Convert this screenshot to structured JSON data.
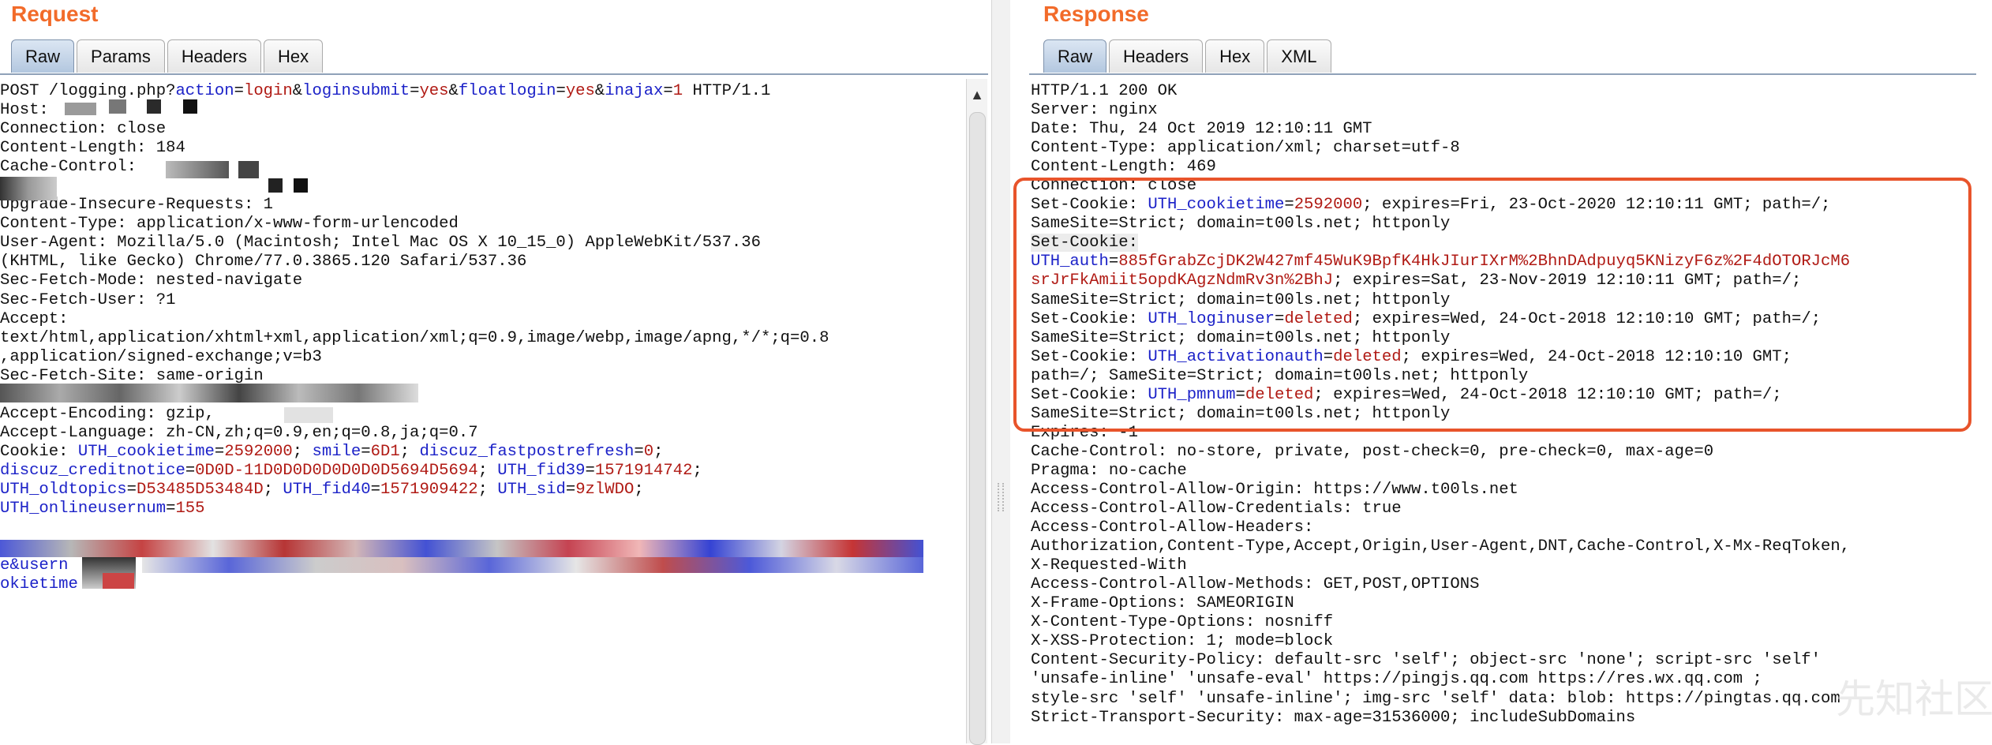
{
  "request": {
    "title": "Request",
    "tabs": [
      "Raw",
      "Params",
      "Headers",
      "Hex"
    ],
    "lines": [
      [
        {
          "t": "POST /logging.php?"
        },
        {
          "t": "action",
          "c": "k"
        },
        {
          "t": "="
        },
        {
          "t": "login",
          "c": "v"
        },
        {
          "t": "&"
        },
        {
          "t": "loginsubmit",
          "c": "k"
        },
        {
          "t": "="
        },
        {
          "t": "yes",
          "c": "v"
        },
        {
          "t": "&"
        },
        {
          "t": "floatlogin",
          "c": "k"
        },
        {
          "t": "="
        },
        {
          "t": "yes",
          "c": "v"
        },
        {
          "t": "&"
        },
        {
          "t": "inajax",
          "c": "k"
        },
        {
          "t": "="
        },
        {
          "t": "1",
          "c": "v"
        },
        {
          "t": " HTTP/1.1"
        }
      ],
      [
        {
          "t": "Host:"
        }
      ],
      [
        {
          "t": "Connection: close"
        }
      ],
      [
        {
          "t": "Content-Length: 184"
        }
      ],
      [
        {
          "t": "Cache-Control:"
        }
      ],
      [
        {
          "t": ""
        }
      ],
      [
        {
          "t": "Upgrade-Insecure-Requests: 1"
        }
      ],
      [
        {
          "t": "Content-Type: application/x-www-form-urlencoded"
        }
      ],
      [
        {
          "t": "User-Agent: Mozilla/5.0 (Macintosh; Intel Mac OS X 10_15_0) AppleWebKit/537.36"
        }
      ],
      [
        {
          "t": "(KHTML, like Gecko) Chrome/77.0.3865.120 Safari/537.36"
        }
      ],
      [
        {
          "t": "Sec-Fetch-Mode: nested-navigate"
        }
      ],
      [
        {
          "t": "Sec-Fetch-User: ?1"
        }
      ],
      [
        {
          "t": "Accept:"
        }
      ],
      [
        {
          "t": "text/html,application/xhtml+xml,application/xml;q=0.9,image/webp,image/apng,*/*;q=0.8"
        }
      ],
      [
        {
          "t": ",application/signed-exchange;v=b3"
        }
      ],
      [
        {
          "t": "Sec-Fetch-Site: same-origin"
        }
      ],
      [
        {
          "t": ""
        }
      ],
      [
        {
          "t": "Accept-Encoding: gzip,"
        }
      ],
      [
        {
          "t": "Accept-Language: zh-CN,zh;q=0.9,en;q=0.8,ja;q=0.7"
        }
      ],
      [
        {
          "t": "Cookie: "
        },
        {
          "t": "UTH_cookietime",
          "c": "k"
        },
        {
          "t": "="
        },
        {
          "t": "2592000",
          "c": "v"
        },
        {
          "t": "; "
        },
        {
          "t": "smile",
          "c": "k"
        },
        {
          "t": "="
        },
        {
          "t": "6D1",
          "c": "v"
        },
        {
          "t": "; "
        },
        {
          "t": "discuz_fastpostrefresh",
          "c": "k"
        },
        {
          "t": "="
        },
        {
          "t": "0",
          "c": "v"
        },
        {
          "t": ";"
        }
      ],
      [
        {
          "t": "discuz_creditnotice",
          "c": "k"
        },
        {
          "t": "="
        },
        {
          "t": "0D0D-11D0D0D0D0D0D0D5694D5694",
          "c": "v"
        },
        {
          "t": "; "
        },
        {
          "t": "UTH_fid39",
          "c": "k"
        },
        {
          "t": "="
        },
        {
          "t": "1571914742",
          "c": "v"
        },
        {
          "t": ";"
        }
      ],
      [
        {
          "t": "UTH_oldtopics",
          "c": "k"
        },
        {
          "t": "="
        },
        {
          "t": "D53485D53484D",
          "c": "v"
        },
        {
          "t": "; "
        },
        {
          "t": "UTH_fid40",
          "c": "k"
        },
        {
          "t": "="
        },
        {
          "t": "1571909422",
          "c": "v"
        },
        {
          "t": "; "
        },
        {
          "t": "UTH_sid",
          "c": "k"
        },
        {
          "t": "="
        },
        {
          "t": "9zlWDO",
          "c": "v"
        },
        {
          "t": ";"
        }
      ],
      [
        {
          "t": "UTH_onlineusernum",
          "c": "k"
        },
        {
          "t": "="
        },
        {
          "t": "155",
          "c": "v"
        }
      ],
      [
        {
          "t": ""
        }
      ],
      [
        {
          "t": ""
        }
      ],
      [
        {
          "t": "e&usern",
          "c": "k"
        }
      ],
      [
        {
          "t": "okietime",
          "c": "k"
        }
      ]
    ]
  },
  "response": {
    "title": "Response",
    "tabs": [
      "Raw",
      "Headers",
      "Hex",
      "XML"
    ],
    "lines": [
      [
        {
          "t": "HTTP/1.1 200 OK"
        }
      ],
      [
        {
          "t": "Server: nginx"
        }
      ],
      [
        {
          "t": "Date: Thu, 24 Oct 2019 12:10:11 GMT"
        }
      ],
      [
        {
          "t": "Content-Type: application/xml; charset=utf-8"
        }
      ],
      [
        {
          "t": "Content-Length: 469"
        }
      ],
      [
        {
          "t": "Connection: close"
        }
      ],
      [
        {
          "t": "Set-Cookie: "
        },
        {
          "t": "UTH_cookietime",
          "c": "k"
        },
        {
          "t": "="
        },
        {
          "t": "2592000",
          "c": "v"
        },
        {
          "t": "; expires=Fri, 23-Oct-2020 12:10:11 GMT; path=/;"
        }
      ],
      [
        {
          "t": "SameSite=Strict; domain=t00ls.net; httponly"
        }
      ],
      [
        {
          "t": "Set-Cookie:",
          "hl": true
        }
      ],
      [
        {
          "t": "UTH_auth",
          "c": "k"
        },
        {
          "t": "="
        },
        {
          "t": "885fGrabZcjDK2W427mf45WuK9BpfK4HkJIurIXrM%2BhnDAdpuyq5KNizyF6z%2F4dOTORJcM6",
          "c": "v"
        }
      ],
      [
        {
          "t": "srJrFkAmiit5opdKAgzNdmRv3n%2BhJ",
          "c": "v"
        },
        {
          "t": "; expires=Sat, 23-Nov-2019 12:10:11 GMT; path=/;"
        }
      ],
      [
        {
          "t": "SameSite=Strict; domain=t00ls.net; httponly"
        }
      ],
      [
        {
          "t": "Set-Cookie: "
        },
        {
          "t": "UTH_loginuser",
          "c": "k"
        },
        {
          "t": "="
        },
        {
          "t": "deleted",
          "c": "v"
        },
        {
          "t": "; expires=Wed, 24-Oct-2018 12:10:10 GMT; path=/;"
        }
      ],
      [
        {
          "t": "SameSite=Strict; domain=t00ls.net; httponly"
        }
      ],
      [
        {
          "t": "Set-Cookie: "
        },
        {
          "t": "UTH_activationauth",
          "c": "k"
        },
        {
          "t": "="
        },
        {
          "t": "deleted",
          "c": "v"
        },
        {
          "t": "; expires=Wed, 24-Oct-2018 12:10:10 GMT;"
        }
      ],
      [
        {
          "t": "path=/; SameSite=Strict; domain=t00ls.net; httponly"
        }
      ],
      [
        {
          "t": "Set-Cookie: "
        },
        {
          "t": "UTH_pmnum",
          "c": "k"
        },
        {
          "t": "="
        },
        {
          "t": "deleted",
          "c": "v"
        },
        {
          "t": "; expires=Wed, 24-Oct-2018 12:10:10 GMT; path=/;"
        }
      ],
      [
        {
          "t": "SameSite=Strict; domain=t00ls.net; httponly"
        }
      ],
      [
        {
          "t": "Expires: -1"
        }
      ],
      [
        {
          "t": "Cache-Control: no-store, private, post-check=0, pre-check=0, max-age=0"
        }
      ],
      [
        {
          "t": "Pragma: no-cache"
        }
      ],
      [
        {
          "t": "Access-Control-Allow-Origin: https://www.t00ls.net"
        }
      ],
      [
        {
          "t": "Access-Control-Allow-Credentials: true"
        }
      ],
      [
        {
          "t": "Access-Control-Allow-Headers:"
        }
      ],
      [
        {
          "t": "Authorization,Content-Type,Accept,Origin,User-Agent,DNT,Cache-Control,X-Mx-ReqToken,"
        }
      ],
      [
        {
          "t": "X-Requested-With"
        }
      ],
      [
        {
          "t": "Access-Control-Allow-Methods: GET,POST,OPTIONS"
        }
      ],
      [
        {
          "t": "X-Frame-Options: SAMEORIGIN"
        }
      ],
      [
        {
          "t": "X-Content-Type-Options: nosniff"
        }
      ],
      [
        {
          "t": "X-XSS-Protection: 1; mode=block"
        }
      ],
      [
        {
          "t": "Content-Security-Policy: default-src 'self'; object-src 'none'; script-src 'self'"
        }
      ],
      [
        {
          "t": "'unsafe-inline' 'unsafe-eval' https://pingjs.qq.com https://res.wx.qq.com ;"
        }
      ],
      [
        {
          "t": "style-src 'self' 'unsafe-inline'; img-src 'self' data: blob: https://pingtas.qq.com"
        }
      ],
      [
        {
          "t": "Strict-Transport-Security: max-age=31536000; includeSubDomains"
        }
      ]
    ]
  },
  "watermark": "先知社区",
  "colors": {
    "title": "#f26b2a",
    "key": "#1c22c8",
    "value": "#b01a14",
    "highlight_box": "#e8542b"
  }
}
